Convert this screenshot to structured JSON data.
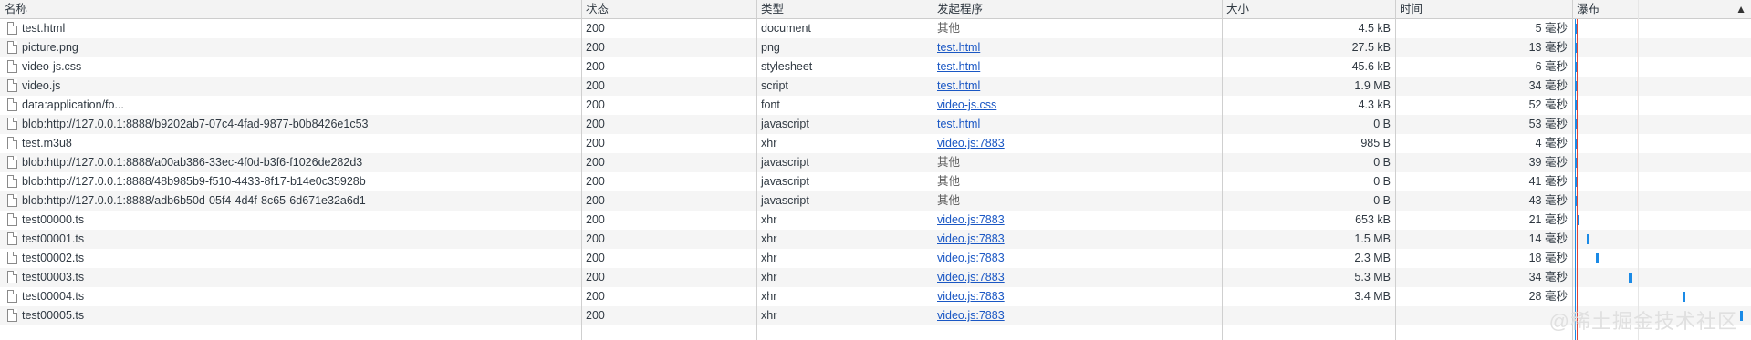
{
  "columns": {
    "name": "名称",
    "status": "状态",
    "type": "类型",
    "initiator": "发起程序",
    "size": "大小",
    "time": "时间",
    "waterfall": "瀑布"
  },
  "sort_icon": "sort-ascending-icon",
  "colors": {
    "link": "#1a57c4",
    "bar": "#1a8ae6",
    "header_bg": "#f3f3f3",
    "stripe_bg": "#f5f5f5"
  },
  "rows": [
    {
      "name": "test.html",
      "status": "200",
      "type": "document",
      "initiator": "其他",
      "initiator_link": false,
      "size": "4.5 kB",
      "time": "5 毫秒",
      "bar_start": 0.0,
      "bar_width": 0.01
    },
    {
      "name": "picture.png",
      "status": "200",
      "type": "png",
      "initiator": "test.html",
      "initiator_link": true,
      "size": "27.5 kB",
      "time": "13 毫秒",
      "bar_start": 0.0,
      "bar_width": 0.01
    },
    {
      "name": "video-js.css",
      "status": "200",
      "type": "stylesheet",
      "initiator": "test.html",
      "initiator_link": true,
      "size": "45.6 kB",
      "time": "6 毫秒",
      "bar_start": 0.0,
      "bar_width": 0.01
    },
    {
      "name": "video.js",
      "status": "200",
      "type": "script",
      "initiator": "test.html",
      "initiator_link": true,
      "size": "1.9 MB",
      "time": "34 毫秒",
      "bar_start": 0.0,
      "bar_width": 0.01
    },
    {
      "name": "data:application/fo...",
      "status": "200",
      "type": "font",
      "initiator": "video-js.css",
      "initiator_link": true,
      "size": "4.3 kB",
      "time": "52 毫秒",
      "bar_start": 0.0,
      "bar_width": 0.01
    },
    {
      "name": "blob:http://127.0.0.1:8888/b9202ab7-07c4-4fad-9877-b0b8426e1c53",
      "status": "200",
      "type": "javascript",
      "initiator": "test.html",
      "initiator_link": true,
      "size": "0 B",
      "time": "53 毫秒",
      "bar_start": 0.0,
      "bar_width": 0.01
    },
    {
      "name": "test.m3u8",
      "status": "200",
      "type": "xhr",
      "initiator": "video.js:7883",
      "initiator_link": true,
      "size": "985 B",
      "time": "4 毫秒",
      "bar_start": 0.0,
      "bar_width": 0.01
    },
    {
      "name": "blob:http://127.0.0.1:8888/a00ab386-33ec-4f0d-b3f6-f1026de282d3",
      "status": "200",
      "type": "javascript",
      "initiator": "其他",
      "initiator_link": false,
      "size": "0 B",
      "time": "39 毫秒",
      "bar_start": 0.0,
      "bar_width": 0.01
    },
    {
      "name": "blob:http://127.0.0.1:8888/48b985b9-f510-4433-8f17-b14e0c35928b",
      "status": "200",
      "type": "javascript",
      "initiator": "其他",
      "initiator_link": false,
      "size": "0 B",
      "time": "41 毫秒",
      "bar_start": 0.0,
      "bar_width": 0.01
    },
    {
      "name": "blob:http://127.0.0.1:8888/adb6b50d-05f4-4d4f-8c65-6d671e32a6d1",
      "status": "200",
      "type": "javascript",
      "initiator": "其他",
      "initiator_link": false,
      "size": "0 B",
      "time": "43 毫秒",
      "bar_start": 0.0,
      "bar_width": 0.01
    },
    {
      "name": "test00000.ts",
      "status": "200",
      "type": "xhr",
      "initiator": "video.js:7883",
      "initiator_link": true,
      "size": "653 kB",
      "time": "21 毫秒",
      "bar_start": 0.01,
      "bar_width": 0.01
    },
    {
      "name": "test00001.ts",
      "status": "200",
      "type": "xhr",
      "initiator": "video.js:7883",
      "initiator_link": true,
      "size": "1.5 MB",
      "time": "14 毫秒",
      "bar_start": 0.07,
      "bar_width": 0.01
    },
    {
      "name": "test00002.ts",
      "status": "200",
      "type": "xhr",
      "initiator": "video.js:7883",
      "initiator_link": true,
      "size": "2.3 MB",
      "time": "18 毫秒",
      "bar_start": 0.12,
      "bar_width": 0.01
    },
    {
      "name": "test00003.ts",
      "status": "200",
      "type": "xhr",
      "initiator": "video.js:7883",
      "initiator_link": true,
      "size": "5.3 MB",
      "time": "34 毫秒",
      "bar_start": 0.31,
      "bar_width": 0.02
    },
    {
      "name": "test00004.ts",
      "status": "200",
      "type": "xhr",
      "initiator": "video.js:7883",
      "initiator_link": true,
      "size": "3.4 MB",
      "time": "28 毫秒",
      "bar_start": 0.62,
      "bar_width": 0.01
    },
    {
      "name": "test00005.ts",
      "status": "200",
      "type": "xhr",
      "initiator": "video.js:7883",
      "initiator_link": true,
      "size": "",
      "time": "",
      "bar_start": 0.95,
      "bar_width": 0.01
    }
  ],
  "watermark": "@稀土掘金技术社区"
}
